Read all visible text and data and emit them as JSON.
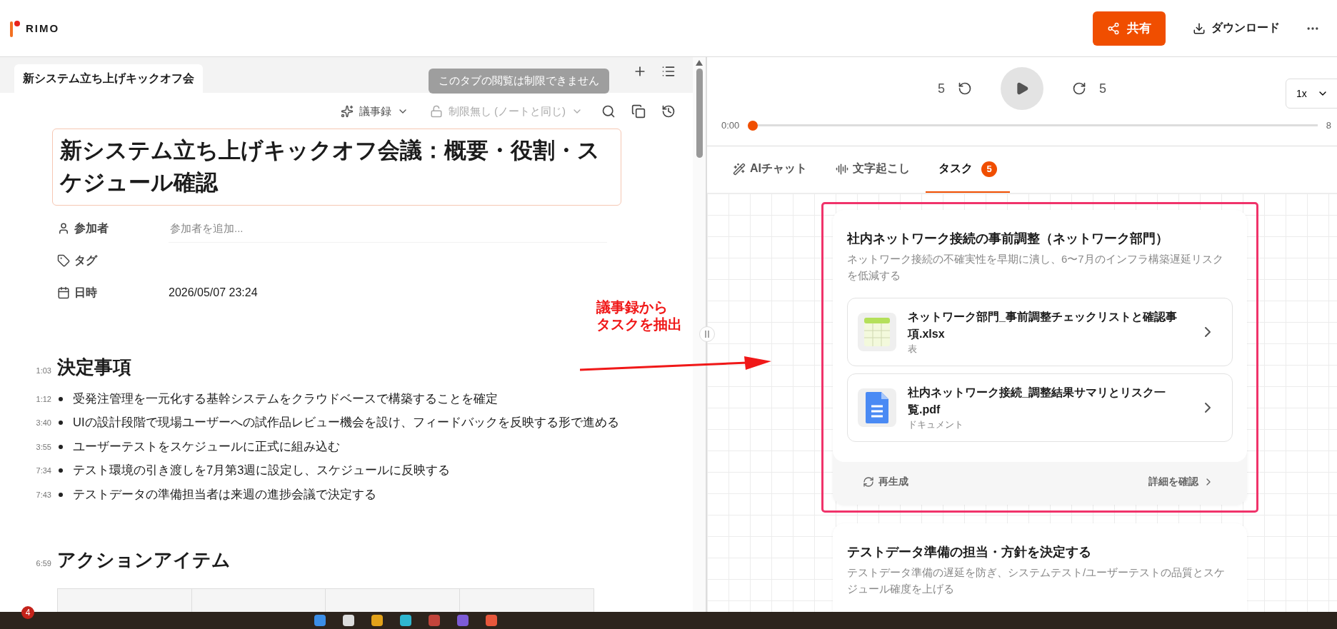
{
  "header": {
    "logo": "RIMO",
    "share": "共有",
    "download": "ダウンロード"
  },
  "note_tabs": [
    {
      "label": "新システム立ち上げキックオフ会",
      "selected": true
    }
  ],
  "tooltip": "このタブの閲覧は制限できません",
  "toolbar": {
    "template": "議事録",
    "access": "制限無し (ノートと同じ)"
  },
  "title": "新システム立ち上げキックオフ会議：概要・役割・スケジュール確認",
  "properties": [
    {
      "kind": "participants",
      "label": "参加者",
      "placeholder": "参加者を追加..."
    },
    {
      "kind": "tags",
      "label": "タグ"
    },
    {
      "kind": "datetime",
      "label": "日時",
      "value": "2026/05/07 23:24"
    }
  ],
  "sections": [
    {
      "kind": "list",
      "time": "1:03",
      "heading": "決定事項",
      "items": [
        {
          "time": "1:12",
          "text": "受発注管理を一元化する基幹システムをクラウドベースで構築することを確定"
        },
        {
          "time": "3:40",
          "text": "UIの設計段階で現場ユーザーへの試作品レビュー機会を設け、フィードバックを反映する形で進める"
        },
        {
          "time": "3:55",
          "text": "ユーザーテストをスケジュールに正式に組み込む"
        },
        {
          "time": "7:34",
          "text": "テスト環境の引き渡しを7月第3週に設定し、スケジュールに反映する"
        },
        {
          "time": "7:43",
          "text": "テストデータの準備担当者は来週の進捗会議で決定する"
        }
      ]
    },
    {
      "kind": "table",
      "time": "6:59",
      "heading": "アクションアイテム"
    }
  ],
  "player": {
    "back": "5",
    "forward": "5",
    "speed": "1x",
    "current": "0:00",
    "total": "8",
    "level": 0
  },
  "panel_tabs": [
    {
      "kind": "ai",
      "label": "AIチャット",
      "selected": false
    },
    {
      "kind": "transcript",
      "label": "文字起こし",
      "selected": false
    },
    {
      "kind": "tasks",
      "label": "タスク",
      "selected": true,
      "badge": "5"
    }
  ],
  "tasks": [
    {
      "title": "社内ネットワーク接続の事前調整（ネットワーク部門）",
      "description": "ネットワーク接続の不確実性を早期に潰し、6〜7月のインフラ構築遅延リスクを低減する",
      "highlighted": true,
      "files": [
        {
          "kind": "sheet",
          "name": "ネットワーク部門_事前調整チェックリストと確認事項.xlsx",
          "type": "表"
        },
        {
          "kind": "doc",
          "name": "社内ネットワーク接続_調整結果サマリとリスク一覧.pdf",
          "type": "ドキュメント"
        }
      ],
      "footer": {
        "regenerate": "再生成",
        "details": "詳細を確認"
      }
    },
    {
      "title": "テストデータ準備の担当・方針を決定する",
      "description": "テストデータ準備の遅延を防ぎ、システムテスト/ユーザーテストの品質とスケジュール確度を上げる",
      "highlighted": false
    }
  ],
  "annotation": {
    "lines": [
      "議事録から",
      "タスクを抽出"
    ]
  },
  "taskbar": {
    "badge": "4"
  }
}
